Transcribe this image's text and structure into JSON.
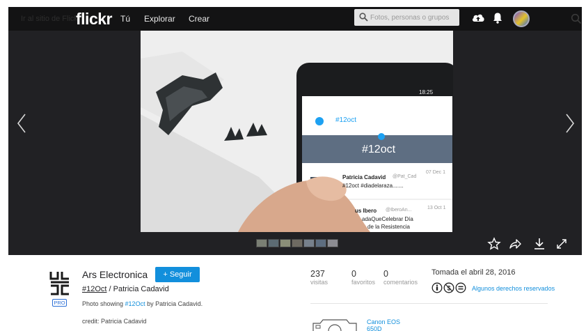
{
  "header": {
    "ghost_text": "Ir al sitio de Flickr",
    "logo": "flickr",
    "nav": [
      "Tú",
      "Explorar",
      "Crear"
    ],
    "search_placeholder": "Fotos, personas o grupos"
  },
  "photo": {
    "app_bar_title": "#12oct",
    "status_time": "18:25",
    "banner_text": "#12oct",
    "tweet1_author": "Patricia Cadavid",
    "tweet1_handle": "@Pat_Cad",
    "tweet1_date": "07 Dec 1",
    "tweet1_text": "#12oct #diadelaraza.......",
    "tweet2_author": "us Ibero",
    "tweet2_handle": "@IberoAn...",
    "tweet2_date": "13 Oct 1",
    "tweet2_line1": "adaQueCelebrar Día",
    "tweet2_line2": "de la Resistencia"
  },
  "filmstrip": {
    "thumbs": [
      "#7a7f74",
      "#5c6b74",
      "#8a8e78",
      "#6e6a62",
      "#76808c",
      "#5d6d80",
      "#8c8c92"
    ]
  },
  "owner": {
    "name": "Ars Electronica",
    "follow_label": "+ Seguir",
    "pro_badge": "PRO"
  },
  "title": {
    "tag": "#12Oct",
    "separator": " / ",
    "author": "Patricia Cadavid"
  },
  "description": {
    "prefix": "Photo showing ",
    "link": "#12Oct",
    "suffix": " by Patricia Cadavid."
  },
  "credit": "credit: Patricia Cadavid",
  "stats": {
    "views": "237",
    "views_label": "visitas",
    "faves": "0",
    "faves_label": "favoritos",
    "comments": "0",
    "comments_label": "comentarios"
  },
  "taken": "Tomada el abril 28, 2016",
  "license": "Algunos derechos reservados",
  "camera": "Canon EOS 650D",
  "colors": {
    "accent": "#128fdc",
    "header_bg": "#131314",
    "stage_bg": "#212124"
  }
}
